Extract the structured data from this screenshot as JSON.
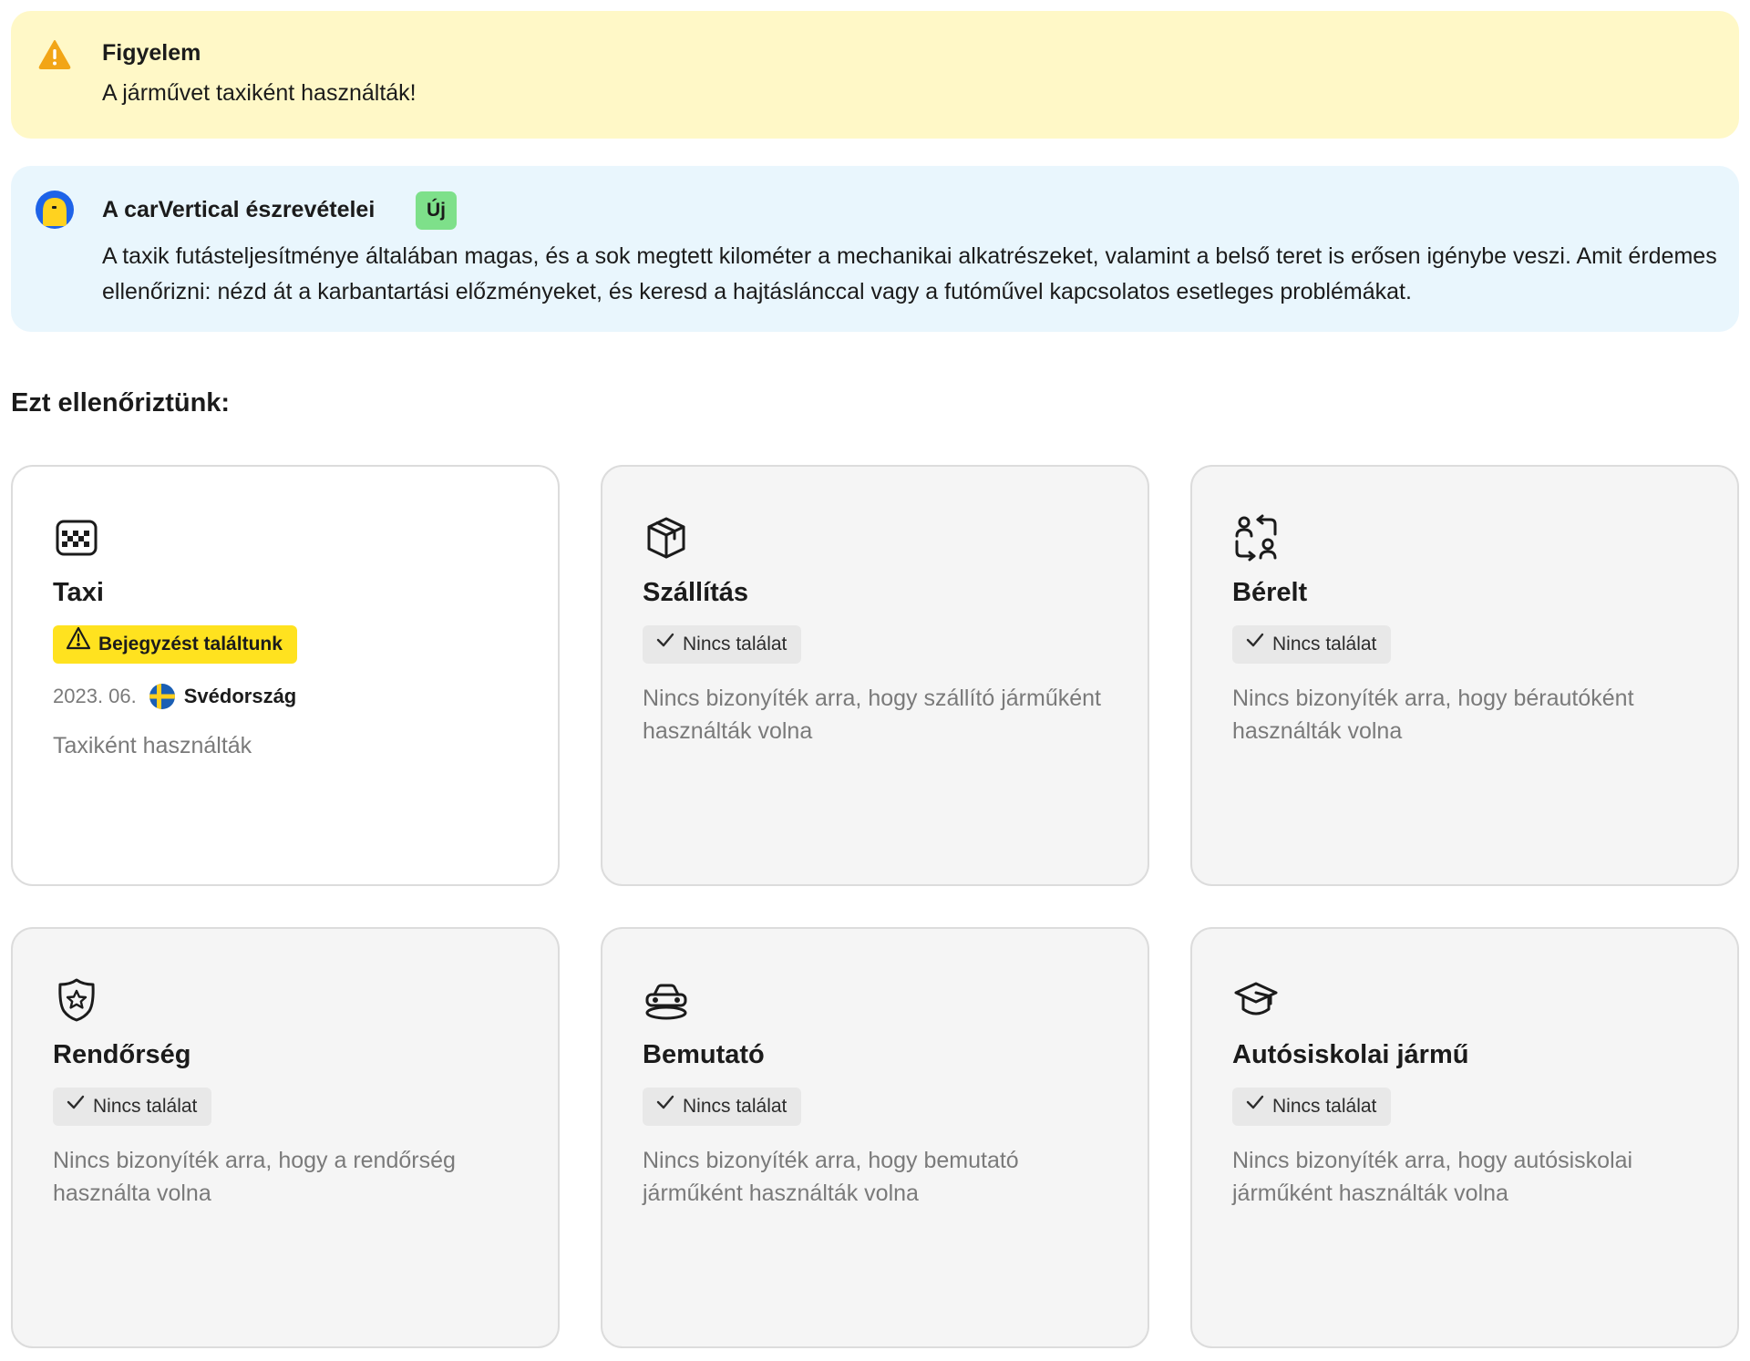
{
  "warning": {
    "title": "Figyelem",
    "text": "A járművet taxiként használták!",
    "icon": "warning-triangle-icon",
    "color": "#fff8c7"
  },
  "insight": {
    "title": "A carVertical észrevételei",
    "badge": "Új",
    "text": "A taxik futásteljesítménye általában magas, és a sok megtett kilométer a mechanikai alkatrészeket, valamint a belső teret is erősen igénybe veszi. Amit érdemes ellenőrizni: nézd át a karbantartási előzményeket, és keresd a hajtáslánccal vagy a futóművel kapcsolatos esetleges problémákat.",
    "icon": "carvertical-logo-icon",
    "color": "#e9f6fd"
  },
  "section_title": "Ezt ellenőriztünk:",
  "cards": [
    {
      "title": "Taxi",
      "icon": "taxi-icon",
      "status": "Bejegyzést találtunk",
      "date": "2023. 06.",
      "country": "Svédország",
      "note": "Taxiként használták"
    },
    {
      "title": "Szállítás",
      "icon": "package-icon",
      "status": "Nincs találat",
      "description": "Nincs bizonyíték arra, hogy szállító járműként használták volna"
    },
    {
      "title": "Bérelt",
      "icon": "rental-exchange-icon",
      "status": "Nincs találat",
      "description": "Nincs bizonyíték arra, hogy bérautóként használták volna"
    },
    {
      "title": "Rendőrség",
      "icon": "police-badge-icon",
      "status": "Nincs találat",
      "description": "Nincs bizonyíték arra, hogy a rendőrség használta volna"
    },
    {
      "title": "Bemutató",
      "icon": "showroom-car-icon",
      "status": "Nincs találat",
      "description": "Nincs bizonyíték arra, hogy bemutató járműként használták volna"
    },
    {
      "title": "Autósiskolai jármű",
      "icon": "graduation-cap-icon",
      "status": "Nincs találat",
      "description": "Nincs bizonyíték arra, hogy autósiskolai járműként használták volna"
    }
  ],
  "colors": {
    "found_badge": "#ffe21f",
    "none_badge": "#e8e8e8",
    "new_badge": "#7ee08a",
    "muted_text": "#7a7a7a"
  }
}
